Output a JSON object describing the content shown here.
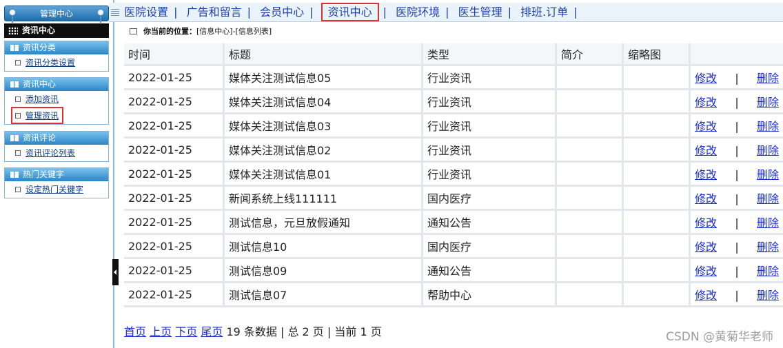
{
  "sidebar": {
    "title": "管理中心",
    "current": "资讯中心",
    "groups": [
      {
        "head": "资讯分类",
        "items": [
          "资讯分类设置"
        ]
      },
      {
        "head": "资讯中心",
        "items": [
          "添加资讯",
          "管理资讯"
        ]
      },
      {
        "head": "资讯评论",
        "items": [
          "资讯评论列表"
        ]
      },
      {
        "head": "热门关键字",
        "items": [
          "设定热门关键字"
        ]
      }
    ]
  },
  "topnav": {
    "items": [
      "医院设置",
      "广告和留言",
      "会员中心",
      "资讯中心",
      "医院环境",
      "医生管理",
      "排班.订单"
    ],
    "separator": "|",
    "active": "资讯中心"
  },
  "location": {
    "label": "你当前的位置：",
    "path": "[信息中心]-[信息列表]"
  },
  "table": {
    "headers": [
      "时间",
      "标题",
      "类型",
      "简介",
      "缩略图",
      ""
    ],
    "rows": [
      {
        "date": "2022-01-25",
        "title": "媒体关注测试信息05",
        "type": "行业资讯",
        "intro": "",
        "thumb": ""
      },
      {
        "date": "2022-01-25",
        "title": "媒体关注测试信息04",
        "type": "行业资讯",
        "intro": "",
        "thumb": ""
      },
      {
        "date": "2022-01-25",
        "title": "媒体关注测试信息03",
        "type": "行业资讯",
        "intro": "",
        "thumb": ""
      },
      {
        "date": "2022-01-25",
        "title": "媒体关注测试信息02",
        "type": "行业资讯",
        "intro": "",
        "thumb": ""
      },
      {
        "date": "2022-01-25",
        "title": "媒体关注测试信息01",
        "type": "行业资讯",
        "intro": "",
        "thumb": ""
      },
      {
        "date": "2022-01-25",
        "title": "新闻系统上线111111",
        "type": "国内医疗",
        "intro": "",
        "thumb": ""
      },
      {
        "date": "2022-01-25",
        "title": "测试信息，元旦放假通知",
        "type": "通知公告",
        "intro": "",
        "thumb": ""
      },
      {
        "date": "2022-01-25",
        "title": "测试信息10",
        "type": "国内医疗",
        "intro": "",
        "thumb": ""
      },
      {
        "date": "2022-01-25",
        "title": "测试信息09",
        "type": "通知公告",
        "intro": "",
        "thumb": ""
      },
      {
        "date": "2022-01-25",
        "title": "测试信息07",
        "type": "帮助中心",
        "intro": "",
        "thumb": ""
      }
    ],
    "edit_label": "修改",
    "delete_label": "删除",
    "op_separator": "|"
  },
  "pager": {
    "first": "首页",
    "prev": "上页",
    "next": "下页",
    "last": "尾页",
    "summary": "19 条数据 | 总 2 页 | 当前 1 页"
  },
  "watermark": "CSDN @黄菊华老师",
  "colors": {
    "accent": "#2b86c7",
    "link": "#1a2dd6",
    "highlight": "#e03030"
  }
}
